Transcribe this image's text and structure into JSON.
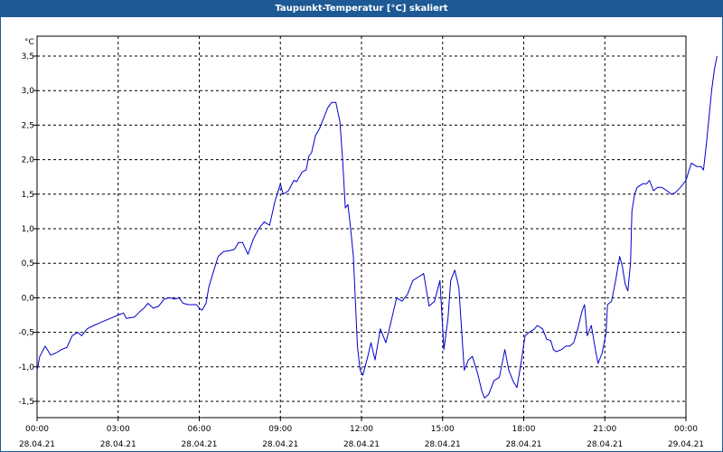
{
  "window": {
    "title": "Taupunkt-Temperatur [°C] skaliert"
  },
  "chart_data": {
    "type": "line",
    "title": "Taupunkt-Temperatur [°C] skaliert",
    "ylabel": "°C",
    "xlabel": "",
    "ylim": [
      -1.75,
      3.75
    ],
    "xlim_hours": [
      0,
      24
    ],
    "grid": true,
    "line_color": "#0000cc",
    "y_ticks": [
      {
        "value": 3.5,
        "label": "3,5"
      },
      {
        "value": 3.0,
        "label": "3,0"
      },
      {
        "value": 2.5,
        "label": "2,5"
      },
      {
        "value": 2.0,
        "label": "2,0"
      },
      {
        "value": 1.5,
        "label": "1,5"
      },
      {
        "value": 1.0,
        "label": "1,0"
      },
      {
        "value": 0.5,
        "label": "0,5"
      },
      {
        "value": 0.0,
        "label": "0,0"
      },
      {
        "value": -0.5,
        "label": "-0,5"
      },
      {
        "value": -1.0,
        "label": "-1,0"
      },
      {
        "value": -1.5,
        "label": "-1,5"
      }
    ],
    "x_ticks": [
      {
        "hour": 0,
        "time": "00:00",
        "date": "28.04.21"
      },
      {
        "hour": 3,
        "time": "03:00",
        "date": "28.04.21"
      },
      {
        "hour": 6,
        "time": "06:00",
        "date": "28.04.21"
      },
      {
        "hour": 9,
        "time": "09:00",
        "date": "28.04.21"
      },
      {
        "hour": 12,
        "time": "12:00",
        "date": "28.04.21"
      },
      {
        "hour": 15,
        "time": "15:00",
        "date": "28.04.21"
      },
      {
        "hour": 18,
        "time": "18:00",
        "date": "28.04.21"
      },
      {
        "hour": 21,
        "time": "21:00",
        "date": "28.04.21"
      },
      {
        "hour": 24,
        "time": "00:00",
        "date": "29.04.21"
      }
    ],
    "series": [
      {
        "points": [
          [
            0.0,
            -1.05
          ],
          [
            0.1,
            -0.85
          ],
          [
            0.3,
            -0.7
          ],
          [
            0.5,
            -0.83
          ],
          [
            0.7,
            -0.8
          ],
          [
            0.9,
            -0.75
          ],
          [
            1.1,
            -0.72
          ],
          [
            1.3,
            -0.55
          ],
          [
            1.5,
            -0.5
          ],
          [
            1.65,
            -0.55
          ],
          [
            1.85,
            -0.45
          ],
          [
            2.1,
            -0.4
          ],
          [
            2.4,
            -0.35
          ],
          [
            2.7,
            -0.3
          ],
          [
            3.0,
            -0.25
          ],
          [
            3.2,
            -0.22
          ],
          [
            3.3,
            -0.3
          ],
          [
            3.6,
            -0.28
          ],
          [
            3.8,
            -0.2
          ],
          [
            3.95,
            -0.15
          ],
          [
            4.1,
            -0.08
          ],
          [
            4.3,
            -0.15
          ],
          [
            4.5,
            -0.12
          ],
          [
            4.7,
            -0.02
          ],
          [
            4.9,
            0.0
          ],
          [
            5.1,
            -0.02
          ],
          [
            5.25,
            0.0
          ],
          [
            5.4,
            -0.08
          ],
          [
            5.6,
            -0.1
          ],
          [
            5.9,
            -0.1
          ],
          [
            6.0,
            -0.15
          ],
          [
            6.1,
            -0.18
          ],
          [
            6.25,
            -0.08
          ],
          [
            6.35,
            0.15
          ],
          [
            6.5,
            0.35
          ],
          [
            6.7,
            0.6
          ],
          [
            6.9,
            0.67
          ],
          [
            7.1,
            0.68
          ],
          [
            7.3,
            0.7
          ],
          [
            7.45,
            0.8
          ],
          [
            7.6,
            0.8
          ],
          [
            7.8,
            0.63
          ],
          [
            8.0,
            0.85
          ],
          [
            8.2,
            1.0
          ],
          [
            8.4,
            1.1
          ],
          [
            8.6,
            1.05
          ],
          [
            8.8,
            1.4
          ],
          [
            9.0,
            1.65
          ],
          [
            9.1,
            1.5
          ],
          [
            9.3,
            1.55
          ],
          [
            9.5,
            1.7
          ],
          [
            9.6,
            1.68
          ],
          [
            9.7,
            1.75
          ],
          [
            9.8,
            1.82
          ],
          [
            9.95,
            1.85
          ],
          [
            10.05,
            2.05
          ],
          [
            10.15,
            2.1
          ],
          [
            10.3,
            2.35
          ],
          [
            10.45,
            2.45
          ],
          [
            10.6,
            2.6
          ],
          [
            10.75,
            2.75
          ],
          [
            10.9,
            2.83
          ],
          [
            11.05,
            2.83
          ],
          [
            11.2,
            2.55
          ],
          [
            11.3,
            2.0
          ],
          [
            11.4,
            1.3
          ],
          [
            11.5,
            1.35
          ],
          [
            11.6,
            1.0
          ],
          [
            11.7,
            0.6
          ],
          [
            11.85,
            -0.7
          ],
          [
            11.95,
            -1.05
          ],
          [
            12.05,
            -1.12
          ],
          [
            12.2,
            -0.9
          ],
          [
            12.35,
            -0.65
          ],
          [
            12.5,
            -0.9
          ],
          [
            12.7,
            -0.45
          ],
          [
            12.8,
            -0.55
          ],
          [
            12.9,
            -0.65
          ],
          [
            13.0,
            -0.5
          ],
          [
            13.15,
            -0.25
          ],
          [
            13.3,
            0.0
          ],
          [
            13.5,
            -0.05
          ],
          [
            13.7,
            0.05
          ],
          [
            13.9,
            0.25
          ],
          [
            14.1,
            0.3
          ],
          [
            14.3,
            0.35
          ],
          [
            14.5,
            -0.12
          ],
          [
            14.7,
            -0.05
          ],
          [
            14.9,
            0.25
          ],
          [
            15.05,
            -0.75
          ],
          [
            15.2,
            -0.3
          ],
          [
            15.3,
            0.25
          ],
          [
            15.45,
            0.4
          ],
          [
            15.6,
            0.15
          ],
          [
            15.8,
            -1.05
          ],
          [
            15.95,
            -0.9
          ],
          [
            16.1,
            -0.85
          ],
          [
            16.3,
            -1.1
          ],
          [
            16.45,
            -1.35
          ],
          [
            16.55,
            -1.45
          ],
          [
            16.7,
            -1.4
          ],
          [
            16.9,
            -1.2
          ],
          [
            17.1,
            -1.15
          ],
          [
            17.3,
            -0.75
          ],
          [
            17.45,
            -1.05
          ],
          [
            17.6,
            -1.2
          ],
          [
            17.75,
            -1.3
          ],
          [
            17.9,
            -0.95
          ],
          [
            18.05,
            -0.55
          ],
          [
            18.2,
            -0.5
          ],
          [
            18.4,
            -0.45
          ],
          [
            18.5,
            -0.4
          ],
          [
            18.7,
            -0.45
          ],
          [
            18.85,
            -0.6
          ],
          [
            19.0,
            -0.62
          ],
          [
            19.1,
            -0.75
          ],
          [
            19.2,
            -0.78
          ],
          [
            19.4,
            -0.75
          ],
          [
            19.55,
            -0.7
          ],
          [
            19.7,
            -0.7
          ],
          [
            19.85,
            -0.65
          ],
          [
            20.0,
            -0.45
          ],
          [
            20.15,
            -0.2
          ],
          [
            20.25,
            -0.1
          ],
          [
            20.35,
            -0.55
          ],
          [
            20.5,
            -0.4
          ],
          [
            20.65,
            -0.75
          ],
          [
            20.75,
            -0.95
          ],
          [
            20.9,
            -0.8
          ],
          [
            21.05,
            -0.5
          ],
          [
            21.1,
            -0.1
          ],
          [
            21.25,
            -0.05
          ],
          [
            21.4,
            0.25
          ],
          [
            21.55,
            0.6
          ],
          [
            21.65,
            0.45
          ],
          [
            21.75,
            0.2
          ],
          [
            21.85,
            0.1
          ],
          [
            21.95,
            0.5
          ],
          [
            22.0,
            1.25
          ],
          [
            22.1,
            1.5
          ],
          [
            22.2,
            1.6
          ],
          [
            22.4,
            1.65
          ],
          [
            22.55,
            1.65
          ],
          [
            22.65,
            1.7
          ],
          [
            22.8,
            1.55
          ],
          [
            22.95,
            1.6
          ],
          [
            23.1,
            1.6
          ],
          [
            23.3,
            1.55
          ],
          [
            23.45,
            1.5
          ],
          [
            23.6,
            1.52
          ],
          [
            23.8,
            1.6
          ],
          [
            24.0,
            1.7
          ],
          [
            24.2,
            1.95
          ],
          [
            24.4,
            1.9
          ],
          [
            24.55,
            1.9
          ],
          [
            24.65,
            1.85
          ],
          [
            24.75,
            2.2
          ],
          [
            24.85,
            2.6
          ],
          [
            24.95,
            3.0
          ],
          [
            25.05,
            3.3
          ],
          [
            25.15,
            3.5
          ]
        ]
      }
    ]
  }
}
